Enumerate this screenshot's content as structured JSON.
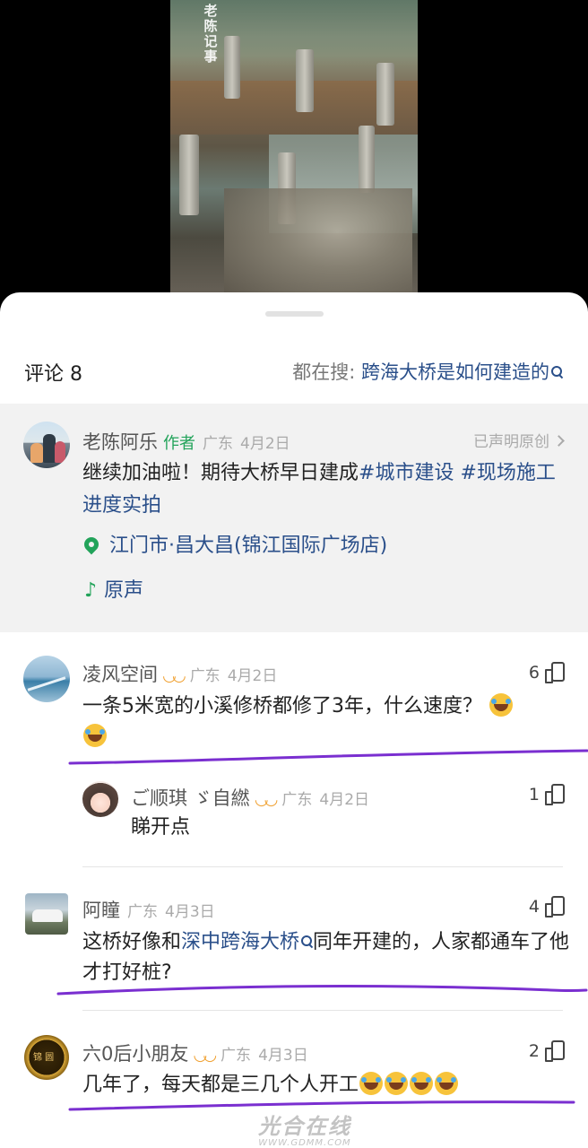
{
  "video": {
    "watermark": "老陈记事"
  },
  "header": {
    "comments_label": "评论 8",
    "search_prefix": "都在搜: ",
    "search_keyword": "跨海大桥是如何建造的"
  },
  "author_post": {
    "name": "老陈阿乐",
    "tag": "作者",
    "region": "广东",
    "date": "4月2日",
    "declared": "已声明原创",
    "text_plain": "继续加油啦！期待大桥早日建成",
    "hashtag1": "#城市建设",
    "hashtag2": "#现场施工进度实拍",
    "location": "江门市·昌大昌(锦江国际广场店)",
    "sound": "原声"
  },
  "comments": [
    {
      "name": "凌风空间",
      "region": "广东",
      "date": "4月2日",
      "likes": "6",
      "text": "一条5米宽的小溪修桥都修了3年，什么速度？"
    },
    {
      "name": "ご顺琪 ゞ自繎",
      "region": "广东",
      "date": "4月2日",
      "likes": "1",
      "text": "睇开点"
    },
    {
      "name": "阿瞳",
      "region": "广东",
      "date": "4月3日",
      "likes": "4",
      "text_a": "这桥好像和",
      "link": "深中跨海大桥",
      "text_b": "同年开建的，人家都通车了他才打好桩?"
    },
    {
      "name": "六0后小朋友",
      "region": "广东",
      "date": "4月3日",
      "likes": "2",
      "text": "几年了，每天都是三几个人开工"
    }
  ],
  "footer_watermark": {
    "main": "光合在线",
    "sub": "WWW.GDMM.COM"
  },
  "colors": {
    "link": "#2a4f8a",
    "green": "#22a35a",
    "vip": "#f0a030",
    "highlight_line": "#7a2fd0"
  }
}
